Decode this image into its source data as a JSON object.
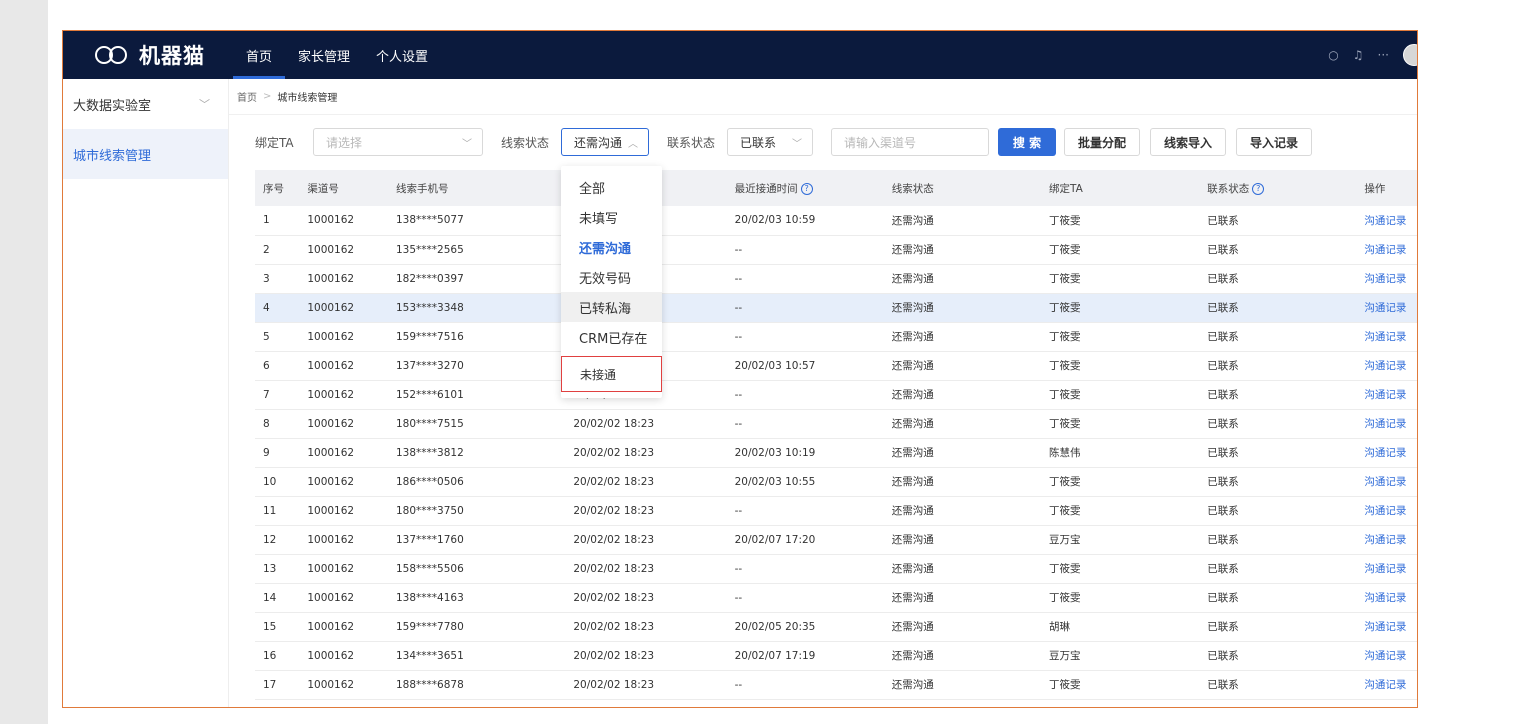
{
  "app": {
    "logo_text": "机器猫"
  },
  "nav": [
    {
      "label": "首页",
      "active": true
    },
    {
      "label": "家长管理",
      "active": false
    },
    {
      "label": "个人设置",
      "active": false
    }
  ],
  "topbar_icons": [
    "search-icon",
    "bell-icon",
    "more-icon",
    "avatar"
  ],
  "sidebar": {
    "group_label": "大数据实验室",
    "items": [
      {
        "label": "城市线索管理",
        "active": true
      }
    ]
  },
  "breadcrumb": {
    "home": "首页",
    "current": "城市线索管理"
  },
  "filters": {
    "ta_label": "绑定TA",
    "ta_placeholder": "请选择",
    "status_label": "线索状态",
    "status_value": "还需沟通",
    "contact_label": "联系状态",
    "contact_value": "已联系",
    "channel_placeholder": "请输入渠道号",
    "search_button": "搜 索",
    "batch_button": "批量分配",
    "import_button": "线索导入",
    "import_log_button": "导入记录"
  },
  "dropdown": {
    "options": [
      "全部",
      "未填写",
      "还需沟通",
      "无效号码",
      "已转私海",
      "CRM已存在",
      "未接通"
    ],
    "selected": "还需沟通",
    "hovered": "已转私海",
    "highlighted_boxed": "未接通"
  },
  "table": {
    "columns": [
      "序号",
      "渠道号",
      "线索手机号",
      "",
      "最近接通时间",
      "线索状态",
      "绑定TA",
      "联系状态",
      "操作"
    ],
    "rows": [
      [
        "1",
        "1000162",
        "138****5077",
        "",
        "20/02/03 10:59",
        "还需沟通",
        "丁筱雯",
        "已联系",
        "沟通记录"
      ],
      [
        "2",
        "1000162",
        "135****2565",
        "",
        "--",
        "还需沟通",
        "丁筱雯",
        "已联系",
        "沟通记录"
      ],
      [
        "3",
        "1000162",
        "182****0397",
        "",
        "--",
        "还需沟通",
        "丁筱雯",
        "已联系",
        "沟通记录"
      ],
      [
        "4",
        "1000162",
        "153****3348",
        "",
        "--",
        "还需沟通",
        "丁筱雯",
        "已联系",
        "沟通记录"
      ],
      [
        "5",
        "1000162",
        "159****7516",
        "",
        "--",
        "还需沟通",
        "丁筱雯",
        "已联系",
        "沟通记录"
      ],
      [
        "6",
        "1000162",
        "137****3270",
        "",
        "20/02/03 10:57",
        "还需沟通",
        "丁筱雯",
        "已联系",
        "沟通记录"
      ],
      [
        "7",
        "1000162",
        "152****6101",
        "20/02/02 18:23",
        "--",
        "还需沟通",
        "丁筱雯",
        "已联系",
        "沟通记录"
      ],
      [
        "8",
        "1000162",
        "180****7515",
        "20/02/02 18:23",
        "--",
        "还需沟通",
        "丁筱雯",
        "已联系",
        "沟通记录"
      ],
      [
        "9",
        "1000162",
        "138****3812",
        "20/02/02 18:23",
        "20/02/03 10:19",
        "还需沟通",
        "陈慧伟",
        "已联系",
        "沟通记录"
      ],
      [
        "10",
        "1000162",
        "186****0506",
        "20/02/02 18:23",
        "20/02/03 10:55",
        "还需沟通",
        "丁筱雯",
        "已联系",
        "沟通记录"
      ],
      [
        "11",
        "1000162",
        "180****3750",
        "20/02/02 18:23",
        "--",
        "还需沟通",
        "丁筱雯",
        "已联系",
        "沟通记录"
      ],
      [
        "12",
        "1000162",
        "137****1760",
        "20/02/02 18:23",
        "20/02/07 17:20",
        "还需沟通",
        "豆万宝",
        "已联系",
        "沟通记录"
      ],
      [
        "13",
        "1000162",
        "158****5506",
        "20/02/02 18:23",
        "--",
        "还需沟通",
        "丁筱雯",
        "已联系",
        "沟通记录"
      ],
      [
        "14",
        "1000162",
        "138****4163",
        "20/02/02 18:23",
        "--",
        "还需沟通",
        "丁筱雯",
        "已联系",
        "沟通记录"
      ],
      [
        "15",
        "1000162",
        "159****7780",
        "20/02/02 18:23",
        "20/02/05 20:35",
        "还需沟通",
        "胡琳",
        "已联系",
        "沟通记录"
      ],
      [
        "16",
        "1000162",
        "134****3651",
        "20/02/02 18:23",
        "20/02/07 17:19",
        "还需沟通",
        "豆万宝",
        "已联系",
        "沟通记录"
      ],
      [
        "17",
        "1000162",
        "188****6878",
        "20/02/02 18:23",
        "--",
        "还需沟通",
        "丁筱雯",
        "已联系",
        "沟通记录"
      ]
    ],
    "highlighted_row": 4
  },
  "colors": {
    "topbar": "#0b1a3d",
    "accent": "#2f6bd8",
    "frame_border": "#e07a3a",
    "dropdown_highlight": "#e04040"
  }
}
